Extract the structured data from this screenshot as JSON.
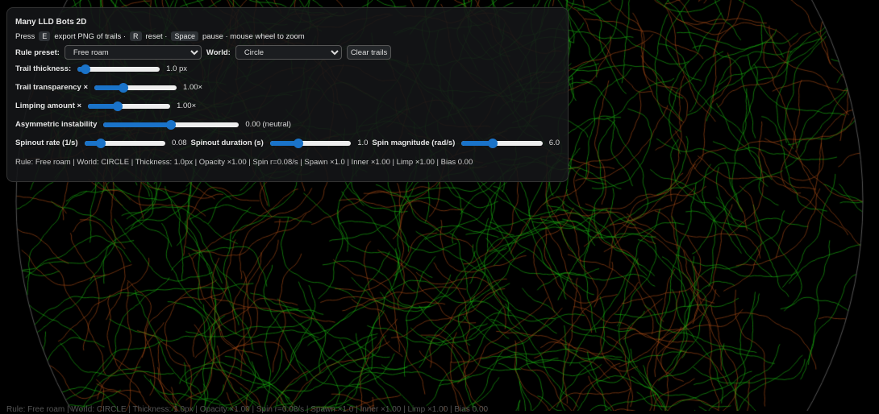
{
  "app": {
    "title": "Many LLD Bots 2D"
  },
  "help": {
    "press": "Press",
    "key_e": "E",
    "export": "export PNG of trails ·",
    "key_r": "R",
    "reset": "reset ·",
    "key_space": "Space",
    "pause": "pause · mouse wheel to zoom"
  },
  "controls": {
    "rule_label": "Rule preset:",
    "rule_value": "Free roam",
    "world_label": "World:",
    "world_value": "Circle",
    "clear_label": "Clear trails",
    "sliders": [
      {
        "label": "Trail thickness:",
        "value": "1.0 px",
        "level": 0.1
      },
      {
        "label": "Trail transparency ×",
        "value": "1.00×",
        "level": 0.35
      },
      {
        "label": "Limping amount ×",
        "value": "1.00×",
        "level": 0.36
      },
      {
        "label": "Asymmetric instability",
        "value": "0.00 (neutral)",
        "level": 0.5
      },
      {
        "label": "Spinout rate (1/s)",
        "value": "0.08",
        "level": 0.2
      },
      {
        "label": "Spinout duration (s)",
        "value": "1.0",
        "level": 0.35
      },
      {
        "label": "Spin magnitude (rad/s)",
        "value": "6.0",
        "level": 0.38
      }
    ]
  },
  "status": "Rule: Free roam | World: CIRCLE | Thickness: 1.0px | Opacity ×1.00 | Spin r=0.08/s | Spawn ×1.0 | Inner ×1.00 | Limp ×1.00 | Bias 0.00",
  "colors": {
    "accent": "#1a73c9",
    "trail_green": "#22c21a",
    "trail_orange": "#c0561a",
    "world_border": "#555555"
  }
}
